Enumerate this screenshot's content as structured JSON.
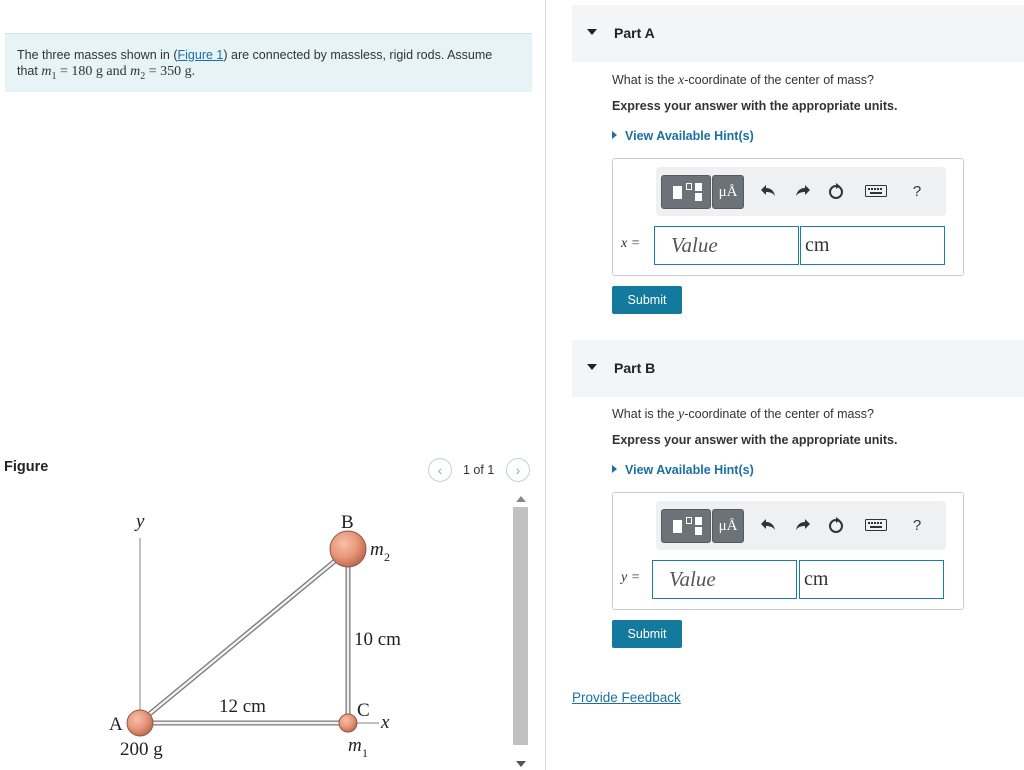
{
  "problem": {
    "text_before_link": "The three masses shown in (",
    "link": "Figure 1",
    "text_after_link": ") are connected by massless, rigid rods. Assume",
    "line2_prefix": "that ",
    "m1_symbol": "m",
    "m1_sub": "1",
    "m1_value": " = 180 g and ",
    "m2_symbol": "m",
    "m2_sub": "2",
    "m2_value": " = 350 g."
  },
  "figure": {
    "title": "Figure",
    "pager": "1 of 1",
    "prev_icon": "chevron-left-icon",
    "next_icon": "chevron-right-icon",
    "labels": {
      "y_axis": "y",
      "x_axis": "x",
      "point_a": "A",
      "point_b": "B",
      "point_c": "C",
      "mass_a": "200 g",
      "m2": "m",
      "m2_sub": "2",
      "m1": "m",
      "m1_sub": "1",
      "horizontal": "12 cm",
      "vertical": "10 cm"
    },
    "colors": {
      "mass_fill": "#e8967a",
      "mass_stroke": "#8c5a44",
      "rod": "#777777"
    }
  },
  "partA": {
    "title": "Part A",
    "question_prefix": "What is the ",
    "question_var": "x",
    "question_suffix": "-coordinate of the center of mass?",
    "instruction": "Express your answer with the appropriate units.",
    "hint": "View Available Hint(s)",
    "var_label": "x =",
    "value_placeholder": "Value",
    "unit_value": "cm",
    "submit": "Submit"
  },
  "partB": {
    "title": "Part B",
    "question_prefix": "What is the ",
    "question_var": "y",
    "question_suffix": "-coordinate of the center of mass?",
    "instruction": "Express your answer with the appropriate units.",
    "hint": "View Available Hint(s)",
    "var_label": "y =",
    "value_placeholder": "Value",
    "unit_value": "cm",
    "submit": "Submit"
  },
  "toolbar": {
    "units_button": "μÅ",
    "help": "?",
    "icons": [
      "templates-icon",
      "units-icon",
      "undo-icon",
      "redo-icon",
      "reset-icon",
      "keyboard-icon",
      "help-icon"
    ]
  },
  "feedback": "Provide Feedback",
  "accent": "#137a9e"
}
